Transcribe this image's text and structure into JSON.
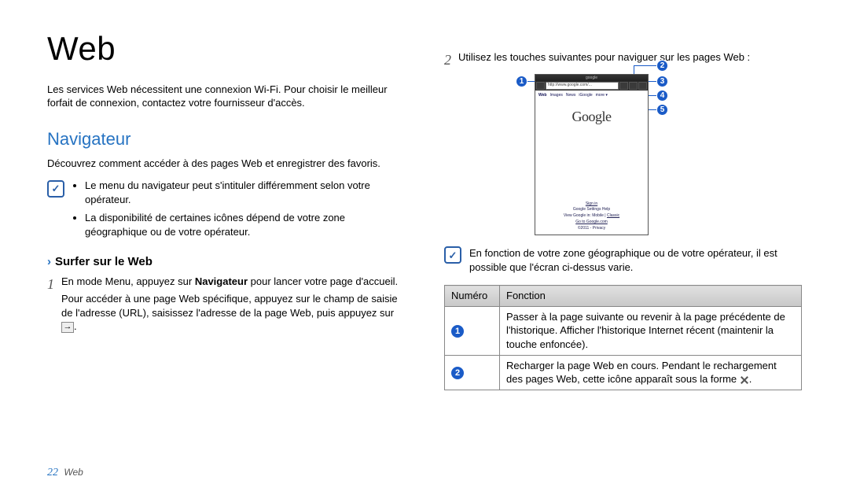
{
  "page": {
    "title": "Web",
    "intro": "Les services Web nécessitent une connexion Wi-Fi. Pour choisir le meilleur forfait de connexion, contactez votre fournisseur d'accès.",
    "number": "22",
    "footer_section": "Web"
  },
  "navigator": {
    "heading": "Navigateur",
    "desc": "Découvrez comment accéder à des pages Web et enregistrer des favoris.",
    "note_glyph": "✓",
    "notes": {
      "item1": "Le menu du navigateur peut s'intituler différemment selon votre opérateur.",
      "item2": "La disponibilité de certaines icônes dépend de votre zone géographique ou de votre opérateur."
    },
    "sub_heading": "Surfer sur le Web",
    "steps": {
      "n1": "1",
      "s1a": "En mode Menu, appuyez sur ",
      "s1b": "Navigateur",
      "s1c": " pour lancer votre page d'accueil.",
      "s1d": "Pour accéder à une page Web spécifique, appuyez sur le champ de saisie de l'adresse (URL), saisissez l'adresse de la page Web, puis appuyez sur ",
      "go_icon": "→",
      "s1e": ".",
      "n2": "2",
      "s2": "Utilisez les touches suivantes pour naviguer sur les pages Web :"
    }
  },
  "figure": {
    "titlebar": "google",
    "url": "http://www.google.com/...",
    "tabs": {
      "web": "Web",
      "images": "Images",
      "news": "News",
      "igoogle": "iGoogle",
      "more": "more ▾"
    },
    "logo": "Google",
    "footer": {
      "signin": "Sign in",
      "links": "Google    Settings    Help",
      "viewin_a": "View Google in: Mobile | ",
      "viewin_b": "Classic",
      "goto": "Go to Google.com",
      "legal": "©2011 - Privacy"
    },
    "callouts": {
      "c1": "1",
      "c2": "2",
      "c3": "3",
      "c4": "4",
      "c5": "5"
    }
  },
  "right_note": {
    "glyph": "✓",
    "text": "En fonction de votre zone géographique ou de votre opérateur, il est possible que l'écran ci-dessus varie."
  },
  "table": {
    "h1": "Numéro",
    "h2": "Fonction",
    "r1num": "1",
    "r1": "Passer à la page suivante ou revenir à la page précédente de l'historique. Afficher l'historique Internet récent (maintenir la touche enfoncée).",
    "r2num": "2",
    "r2a": "Recharger la page Web en cours. Pendant le rechargement des pages Web, cette icône apparaît sous la forme ",
    "r2b": "."
  }
}
